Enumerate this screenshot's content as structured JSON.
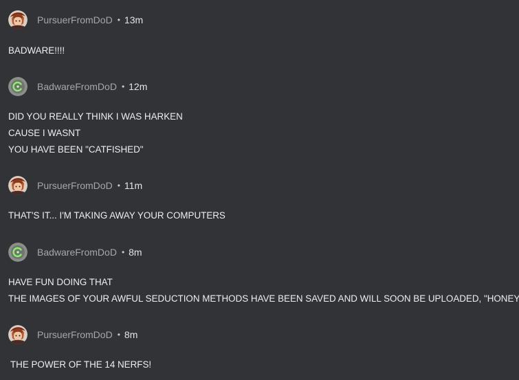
{
  "comments": [
    {
      "username": "PursuerFromDoD",
      "separator": "•",
      "time": "13m",
      "avatar_icon": "character-portrait-icon",
      "lines": [
        "BADWARE!!!!"
      ]
    },
    {
      "username": "BadwareFromDoD",
      "separator": "•",
      "time": "12m",
      "avatar_icon": "green-logo-icon",
      "lines": [
        "DID YOU REALLY THINK I WAS HARKEN",
        "CAUSE I WASNT",
        "YOU HAVE BEEN \"CATFISHED\""
      ]
    },
    {
      "username": "PursuerFromDoD",
      "separator": "•",
      "time": "11m",
      "avatar_icon": "character-portrait-icon",
      "lines": [
        "THAT'S IT... I'M TAKING AWAY YOUR COMPUTERS"
      ]
    },
    {
      "username": "BadwareFromDoD",
      "separator": "•",
      "time": "8m",
      "avatar_icon": "green-logo-icon",
      "lines": [
        "HAVE FUN DOING THAT",
        "THE IMAGES OF YOUR AWFUL SEDUCTION METHODS HAVE BEEN SAVED AND WILL SOON BE UPLOADED, \"HONEY\""
      ]
    },
    {
      "username": "PursuerFromDoD",
      "separator": "•",
      "time": "8m",
      "avatar_icon": "character-portrait-icon",
      "lines": [
        " THE POWER OF THE 14 NERFS!"
      ]
    }
  ],
  "colors": {
    "background": "#323337",
    "username": "#a6a7ad",
    "time": "#e4e5e8",
    "text": "#eceef1"
  }
}
